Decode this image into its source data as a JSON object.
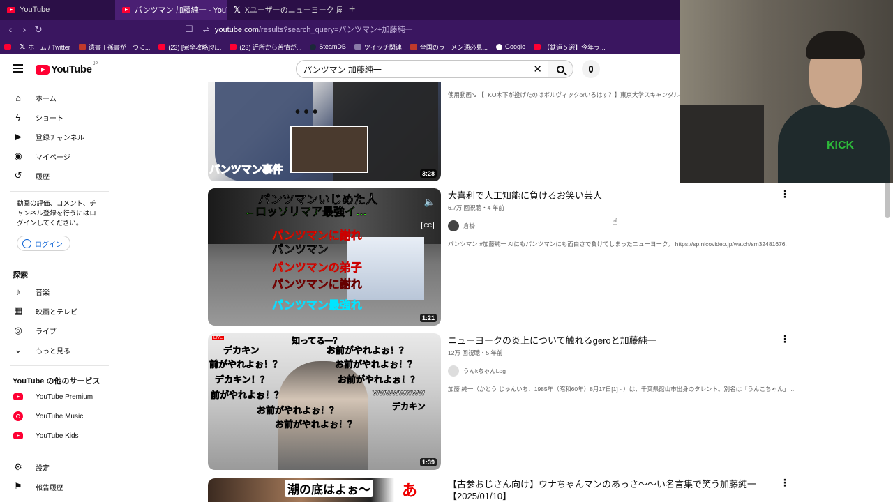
{
  "browser": {
    "tabs": [
      {
        "title": "YouTube"
      },
      {
        "title": "パンツマン 加藤純一 - YouTube"
      },
      {
        "title": "Xユーザーのニューヨーク 屋敷さん: 「パンツマ"
      }
    ],
    "url_domain": "youtube.com",
    "url_path": "/results?search_query=パンツマン+加藤純一",
    "bookmarks": [
      "ホーム / Twitter",
      "遺書＋孫書が一つに...",
      "(23) [完全攻略]切...",
      "(23) 近所から苦情が...",
      "SteamDB",
      "ツイッチ関連",
      "全国のラーメン通必見...",
      "Google",
      "【鉄道５選】今年ラ..."
    ]
  },
  "header": {
    "logo_text": "YouTube",
    "logo_region": "JP",
    "search_value": "パンツマン 加藤純一"
  },
  "sidebar": {
    "main": [
      "ホーム",
      "ショート",
      "登録チャンネル",
      "マイページ",
      "履歴"
    ],
    "login_prompt": "動画の評価、コメント、チャンネル登録を行うにはログインしてください。",
    "login_button": "ログイン",
    "explore_heading": "探索",
    "explore": [
      "音楽",
      "映画とテレビ",
      "ライブ",
      "もっと見る"
    ],
    "services_heading": "YouTube の他のサービス",
    "services": [
      "YouTube Premium",
      "YouTube Music",
      "YouTube Kids"
    ],
    "settings": [
      "設定",
      "報告履歴"
    ]
  },
  "results": [
    {
      "title": "",
      "stats": "",
      "channel": "",
      "description": "使用動画↘ 【TKO木下が投げたのはボルヴィックorいろはす？】東京大学スキャンダル学部",
      "duration": "3:28",
      "thumb_text": [
        "パンツマン事件"
      ]
    },
    {
      "title": "大喜利で人工知能に負けるお笑い芸人",
      "stats": "6.7万 回視聴・4 年前",
      "channel": "倉掛",
      "description": "パンツマン #加藤純一 AIにもパンツマンにも面白さで負けてしまったニューヨーク。 https://sp.nicovideo.jp/watch/sm32481676.",
      "duration": "1:21",
      "thumb_text": [
        "パンツマンいじめた人",
        "←ロッソリマア最強イ…",
        "パンツマンに謝れ",
        "パンツマン",
        "パンツマンの弟子",
        "パンツマンに謝れ",
        "パンツマン最強れ"
      ]
    },
    {
      "title": "ニューヨークの炎上について触れるgeroと加藤純一",
      "stats": "12万 回視聴・5 年前",
      "channel": "うんkちゃんLog",
      "description": "加藤 純一（かとう じゅんいち、1985年（昭和60年）8月17日[1] - ）は、千葉県館山市出身のタレント。別名は「うんこちゃん」 ...",
      "duration": "1:39",
      "thumb_text": [
        "知ってる一？",
        "デカキン",
        "お前がやれよぉ！？",
        "前がやれよぉ！？",
        "お前がやれよぉ！？",
        "デカキン！？",
        "お前がやれよぉ！？",
        "前がやれよぉ！？",
        "wwwwwwww",
        "デカキン",
        "お前がやれよぉ！？",
        "お前がやれよぉ！？"
      ]
    },
    {
      "title": "【古参おじさん向け】ウナちゃんマンのあっさ〜〜い名言集で笑う加藤純一【2025/01/10】",
      "stats": "",
      "channel": "",
      "description": "",
      "duration": "",
      "thumb_text": [
        "潮の底はよぉ〜",
        "あ"
      ]
    }
  ],
  "colors": {
    "browser_tab_bg": "#2b0f47",
    "browser_bar_bg": "#3a1660",
    "yt_red": "#ff0033",
    "link_blue": "#065fd4"
  }
}
